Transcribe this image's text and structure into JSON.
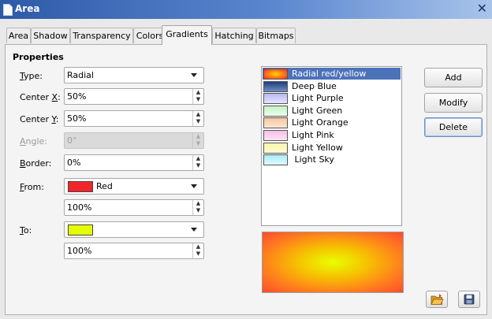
{
  "window": {
    "title": "Area"
  },
  "tabs": [
    "Area",
    "Shadow",
    "Transparency",
    "Colors",
    "Gradients",
    "Hatching",
    "Bitmaps"
  ],
  "active_tab": "Gradients",
  "properties": {
    "heading": "Properties",
    "type": {
      "label_prefix": "",
      "label_accel": "T",
      "label_rest": "ype:",
      "value": "Radial"
    },
    "center_x": {
      "label_prefix": "Center ",
      "label_accel": "X",
      "label_rest": ":",
      "value": "50%"
    },
    "center_y": {
      "label_prefix": "Center ",
      "label_accel": "Y",
      "label_rest": ":",
      "value": "50%"
    },
    "angle": {
      "label_prefix": "",
      "label_accel": "A",
      "label_rest": "ngle:",
      "value": "0°"
    },
    "border": {
      "label_prefix": "",
      "label_accel": "B",
      "label_rest": "order:",
      "value": "0%"
    },
    "from": {
      "label_prefix": "",
      "label_accel": "F",
      "label_rest": "rom:",
      "color_name": "Red",
      "color": "#f0262a",
      "intensity": "100%"
    },
    "to": {
      "label_prefix": "",
      "label_accel": "T",
      "label_rest": "o:",
      "color_name": "",
      "color": "#e6ff00",
      "intensity": "100%"
    }
  },
  "gradient_list": [
    {
      "name": "Radial red/yellow",
      "selected": true,
      "swatch": "radial-gradient(ellipse, #ffd400 0%, #ff5a1e 70%, #e82a2a 100%)"
    },
    {
      "name": "Deep Blue",
      "swatch": "linear-gradient(#1f3d7a, #6f8fc4)"
    },
    {
      "name": "Light Purple",
      "swatch": "linear-gradient(#b9b6f3, #e8e6fd)"
    },
    {
      "name": "Light Green",
      "swatch": "linear-gradient(#c6f2c6, #ecfcec)"
    },
    {
      "name": "Light Orange",
      "swatch": "linear-gradient(#f6c79b, #fde6d2)"
    },
    {
      "name": "Light Pink",
      "swatch": "linear-gradient(#f6bde6, #fde4f6)"
    },
    {
      "name": "Light Yellow",
      "swatch": "linear-gradient(#faf5a6, #fffbd8)"
    },
    {
      "name": " Light Sky",
      "swatch": "linear-gradient(#a9ecf9, #e1f8fd)"
    }
  ],
  "buttons": {
    "add": "Add",
    "modify": "Modify",
    "delete": "Delete"
  },
  "colors": {
    "accent": "#4c72b9",
    "titlebar": "#2d5aa8"
  },
  "icons": {
    "load": "open-folder-icon",
    "save": "floppy-disk-icon"
  }
}
